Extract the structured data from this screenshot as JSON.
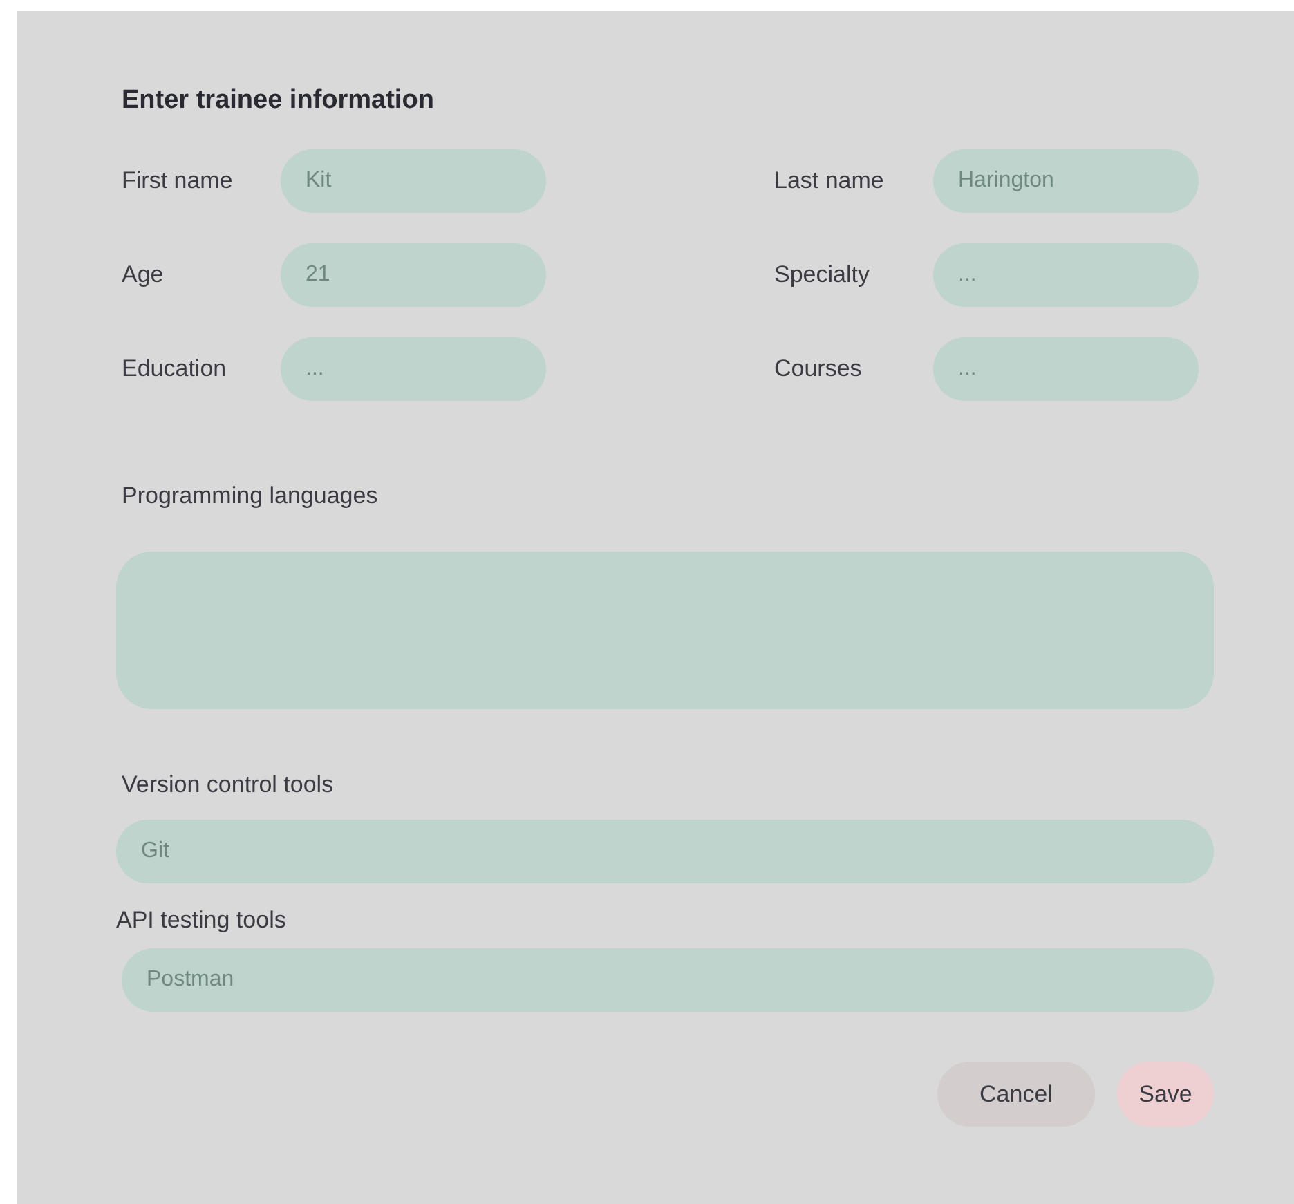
{
  "title": "Enter trainee information",
  "grid_fields": [
    {
      "label": "First name",
      "placeholder": "Kit"
    },
    {
      "label": "Last name",
      "placeholder": "Harington"
    },
    {
      "label": "Age",
      "placeholder": "21"
    },
    {
      "label": "Specialty",
      "placeholder": "..."
    },
    {
      "label": "Education",
      "placeholder": "..."
    },
    {
      "label": "Courses",
      "placeholder": "..."
    }
  ],
  "programming_languages": {
    "label": "Programming languages"
  },
  "version_control_tools": {
    "label": "Version control tools",
    "placeholder": "Git"
  },
  "api_testing_tools": {
    "label": "API testing tools",
    "placeholder": "Postman"
  },
  "buttons": [
    {
      "label": "Cancel",
      "kind": "secondary"
    },
    {
      "label": "Save",
      "kind": "primary"
    }
  ]
}
